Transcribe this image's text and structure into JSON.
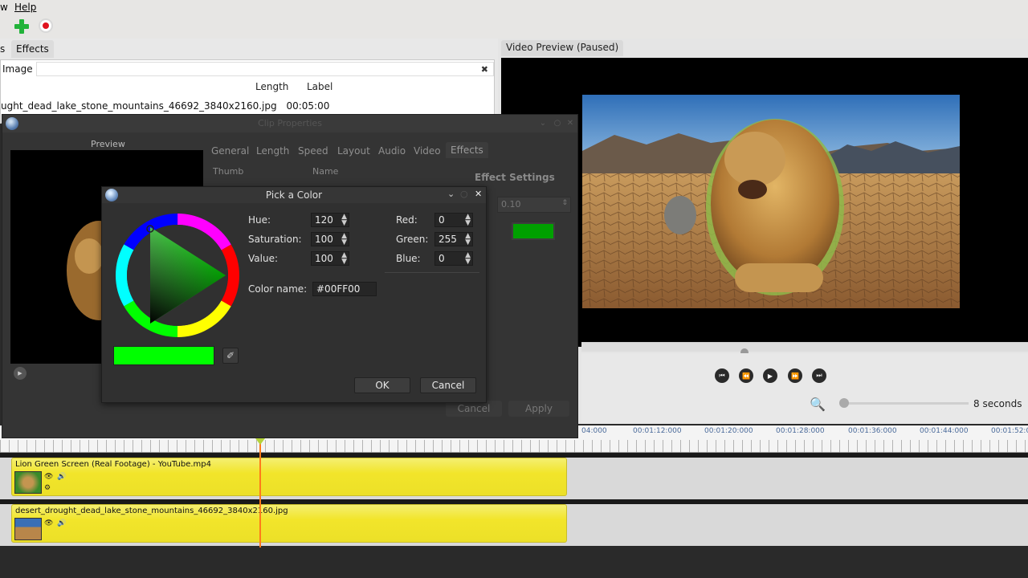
{
  "menu": {
    "partial_view": "w",
    "help": "Help"
  },
  "panel_tabs": {
    "partial": "s",
    "effects": "Effects"
  },
  "project_files": {
    "filter_label": "Image",
    "clear_icon": "✖",
    "columns": {
      "length": "Length",
      "label": "Label"
    },
    "file": {
      "name": "ught_dead_lake_stone_mountains_46692_3840x2160.jpg",
      "length": "00:05:00"
    }
  },
  "video_preview": {
    "tab_label": "Video Preview (Paused)",
    "zoom_value": "8 seconds"
  },
  "clip_properties": {
    "title": "Clip Properties",
    "preview_label": "Preview",
    "tabs": [
      "General",
      "Length",
      "Speed",
      "Layout",
      "Audio",
      "Video",
      "Effects"
    ],
    "active_tab": "Effects",
    "columns": {
      "thumb": "Thumb",
      "name": "Name"
    },
    "effect_settings": "Effect Settings",
    "effect_value": "0.10",
    "buttons": {
      "cancel": "Cancel",
      "apply": "Apply"
    }
  },
  "color_dialog": {
    "title": "Pick a Color",
    "hue_label": "Hue:",
    "hue": "120",
    "saturation_label": "Saturation:",
    "saturation": "100",
    "value_label": "Value:",
    "value": "100",
    "red_label": "Red:",
    "red": "0",
    "green_label": "Green:",
    "green": "255",
    "blue_label": "Blue:",
    "blue": "0",
    "color_name_label": "Color name:",
    "color_name": "#00FF00",
    "ok": "OK",
    "cancel": "Cancel",
    "current_color": "#00ff00"
  },
  "timeline": {
    "ticks": [
      "04:000",
      "00:01:12:000",
      "00:01:20:000",
      "00:01:28:000",
      "00:01:36:000",
      "00:01:44:000",
      "00:01:52:00"
    ],
    "tracks": [
      {
        "clip_title": "Lion Green Screen (Real Footage) - YouTube.mp4"
      },
      {
        "clip_title": "desert_drought_dead_lake_stone_mountains_46692_3840x2160.jpg"
      }
    ]
  }
}
